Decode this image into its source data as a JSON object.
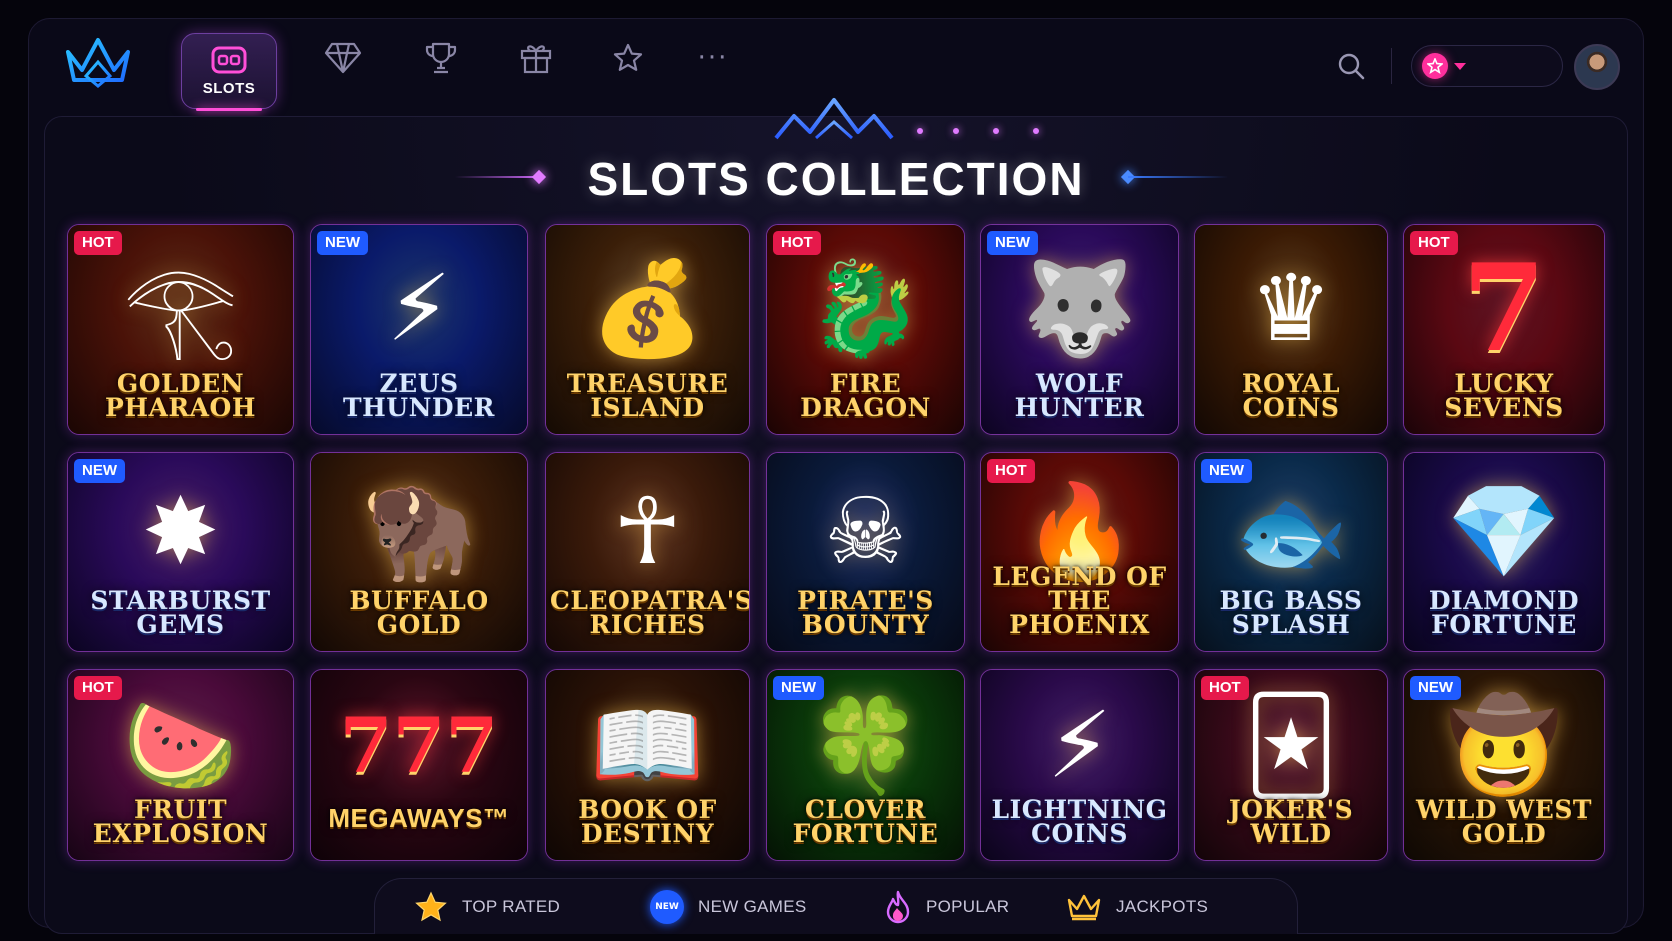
{
  "nav": {
    "logo": "crown-logo-icon",
    "items": [
      {
        "label": "SLOTS",
        "icon": "slot-machine-icon",
        "active": true
      },
      {
        "label": "",
        "icon": "diamond-icon"
      },
      {
        "label": "",
        "icon": "trophy-icon"
      },
      {
        "label": "",
        "icon": "gift-icon"
      },
      {
        "label": "",
        "icon": "star-icon"
      },
      {
        "label": "···",
        "icon": "more-icon"
      }
    ],
    "search_icon": "search-icon",
    "balance": {
      "icon": "pink-star-coin-icon",
      "dropdown_icon": "caret-down-icon",
      "value": ""
    },
    "avatar": "user-avatar"
  },
  "page": {
    "title": "SLOTS COLLECTION"
  },
  "games": [
    {
      "name": "Golden\nPharaoh",
      "badge": "HOT",
      "motif": "𓂀"
    },
    {
      "name": "Zeus\nThunder",
      "badge": "NEW",
      "motif": "⚡"
    },
    {
      "name": "Treasure\nIsland",
      "badge": "",
      "motif": "💰"
    },
    {
      "name": "Fire\nDragon",
      "badge": "HOT",
      "motif": "🐉"
    },
    {
      "name": "Wolf\nHunter",
      "badge": "NEW",
      "motif": "🐺"
    },
    {
      "name": "Royal\nCoins",
      "badge": "",
      "motif": "♛"
    },
    {
      "name": "Lucky\nSevens",
      "badge": "HOT",
      "motif": "7"
    },
    {
      "name": "Starburst\nGems",
      "badge": "NEW",
      "motif": "✸"
    },
    {
      "name": "Buffalo\nGold",
      "badge": "",
      "motif": "🦬"
    },
    {
      "name": "Cleopatra's\nRiches",
      "badge": "",
      "motif": "☥"
    },
    {
      "name": "Pirate's\nBounty",
      "badge": "",
      "motif": "☠"
    },
    {
      "name": "Legend of\nthe Phoenix",
      "badge": "HOT",
      "motif": "🔥"
    },
    {
      "name": "Big Bass\nSplash",
      "badge": "NEW",
      "motif": "🐟"
    },
    {
      "name": "Diamond\nFortune",
      "badge": "",
      "motif": "💎"
    },
    {
      "name": "Fruit\nExplosion",
      "badge": "HOT",
      "motif": "🍉"
    },
    {
      "name": "Megaways™",
      "badge": "",
      "motif": "777"
    },
    {
      "name": "Book of\nDestiny",
      "badge": "",
      "motif": "📖"
    },
    {
      "name": "Clover\nFortune",
      "badge": "NEW",
      "motif": "🍀"
    },
    {
      "name": "Lightning\nCoins",
      "badge": "",
      "motif": "⚡"
    },
    {
      "name": "Joker's\nWild",
      "badge": "HOT",
      "motif": "🃏"
    },
    {
      "name": "Wild West\nGold",
      "badge": "NEW",
      "motif": "🤠"
    }
  ],
  "filters": [
    {
      "label": "TOP RATED",
      "icon": "gold-star-icon"
    },
    {
      "label": "NEW GAMES",
      "icon": "new-badge-icon",
      "icon_text": "NEW"
    },
    {
      "label": "POPULAR",
      "icon": "flame-icon"
    },
    {
      "label": "JACKPOTS",
      "icon": "crown-icon"
    }
  ],
  "colors": {
    "accent_pink": "#ff4fd8",
    "accent_blue": "#1f5bff",
    "hot_badge": "#e6194b",
    "new_badge": "#1f5bff",
    "gold_text": "#ffd36a"
  }
}
